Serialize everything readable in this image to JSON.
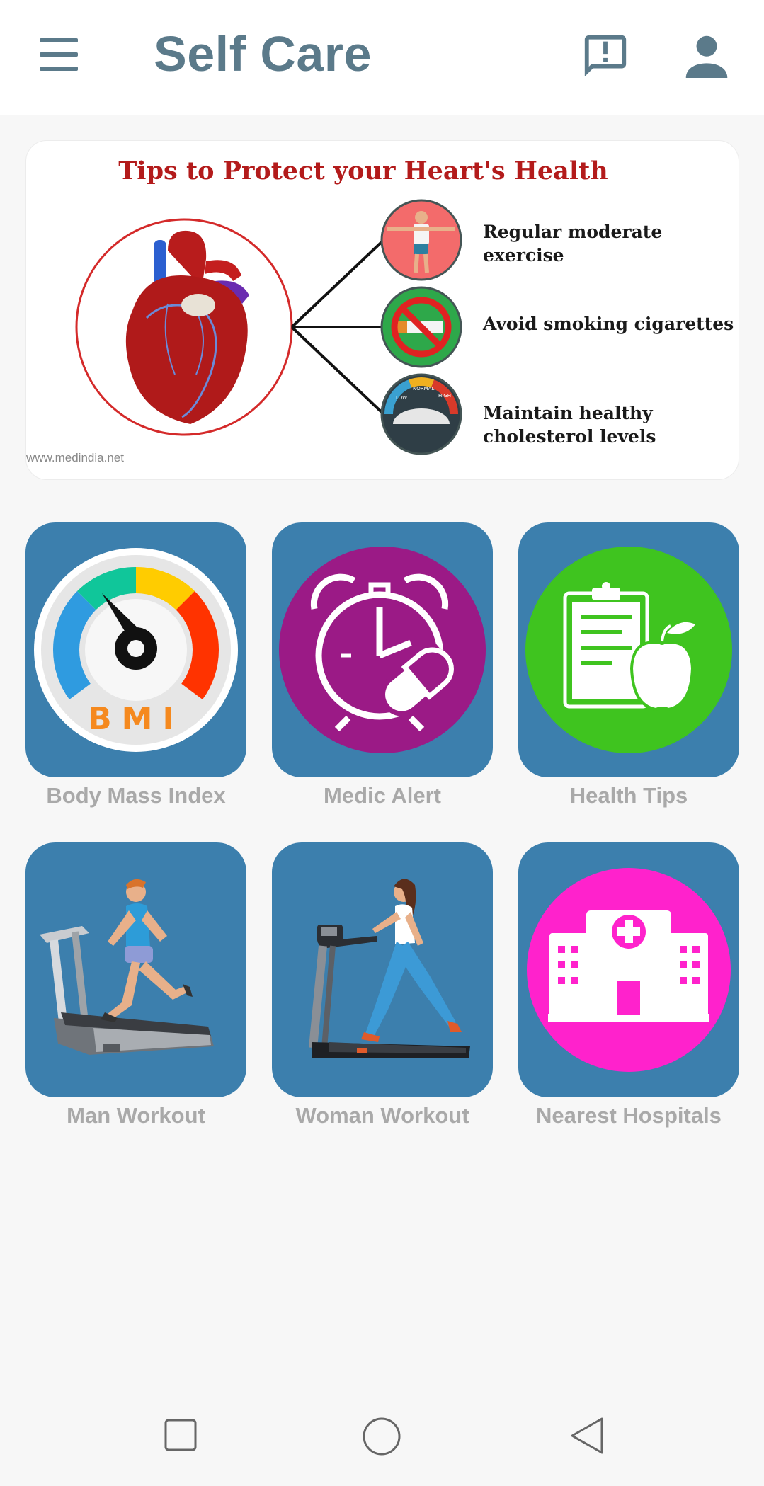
{
  "app": {
    "title": "Self Care"
  },
  "banner": {
    "title": "Tips to Protect your Heart's Health",
    "tips": [
      "Regular moderate exercise",
      "Avoid smoking cigarettes",
      "Maintain healthy cholesterol levels"
    ],
    "gauge_labels": [
      "LOW",
      "NORMAL",
      "HIGH"
    ],
    "watermark": "www.medindia.net"
  },
  "tiles": [
    {
      "label": "Body Mass Index",
      "icon": "bmi-gauge-icon",
      "badge_text": "BMI"
    },
    {
      "label": "Medic Alert",
      "icon": "alarm-clock-pill-icon"
    },
    {
      "label": "Health Tips",
      "icon": "clipboard-apple-icon"
    },
    {
      "label": "Man Workout",
      "icon": "man-treadmill-icon"
    },
    {
      "label": "Woman Workout",
      "icon": "woman-treadmill-icon"
    },
    {
      "label": "Nearest Hospitals",
      "icon": "hospital-icon"
    }
  ],
  "colors": {
    "accent": "#5b7a8a",
    "tile_background": "#3c7fad",
    "label_gray": "#a9a9a9",
    "medic_purple": "#9b1a86",
    "tips_green": "#3fc41f",
    "hospital_pink": "#ff22cc",
    "banner_red": "#b31b1b"
  },
  "navbar": {
    "buttons": [
      "recent-apps",
      "home",
      "back"
    ]
  }
}
